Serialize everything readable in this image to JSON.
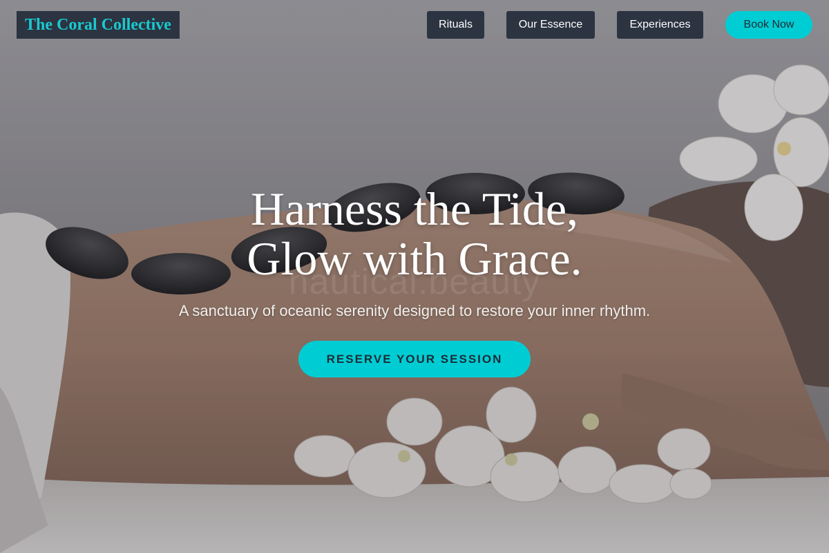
{
  "brand": {
    "name": "The Coral Collective",
    "color": "#19c9cf"
  },
  "nav": {
    "items": [
      {
        "label": "Rituals"
      },
      {
        "label": "Our Essence"
      },
      {
        "label": "Experiences"
      }
    ],
    "cta_label": "Book Now"
  },
  "hero": {
    "headline_line1": "Harness the Tide,",
    "headline_line2": "Glow with Grace.",
    "watermark": "nautical.beauty",
    "tagline": "A sanctuary of oceanic serenity designed to restore your inner rhythm.",
    "cta_label": "RESERVE YOUR SESSION",
    "background_image": "hot-stone-massage-photo"
  },
  "colors": {
    "accent": "#00cdd3",
    "nav_bg": "#2c3341",
    "text_dark": "#1d2a36"
  }
}
